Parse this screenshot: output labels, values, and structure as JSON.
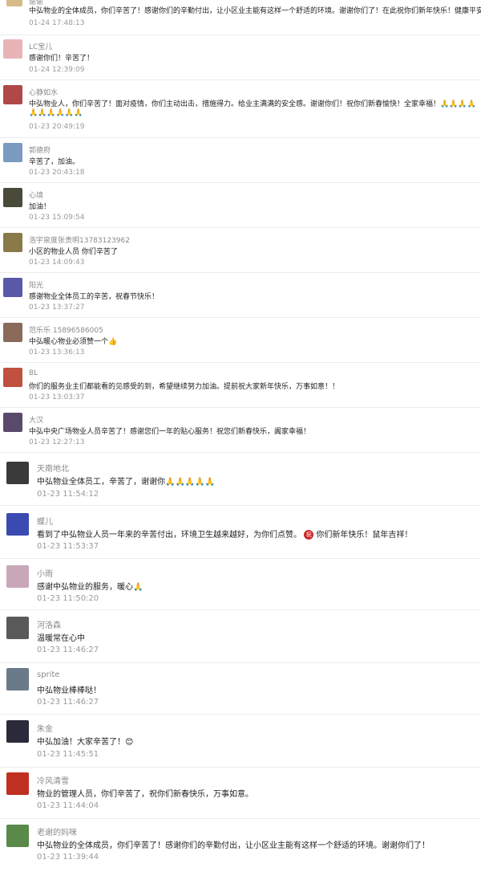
{
  "comments": [
    {
      "name": "谢谢",
      "text": "中弘物业的全体成员，你们辛苦了！感谢你们的辛勤付出，让小区业主能有这样一个舒适的环境。谢谢你们了！在此祝你们新年快乐！健康平安！",
      "time": "01-24 17:48:13",
      "avatar_color": "#d8b98a"
    },
    {
      "name": "LC宝儿",
      "text": "感谢你们！辛苦了！",
      "time": "01-24 12:39:09",
      "avatar_color": "#e8b4b8"
    },
    {
      "name": "心静如水",
      "text": "中弘物业人，你们辛苦了！面对疫情，你们主动出击，措施得力。给业主满满的安全感。谢谢你们！祝你们新春愉快！全家幸福！🙏🙏🙏🙏",
      "text2": "🙏🙏🙏🙏🙏🙏",
      "time": "01-23 20:49:19",
      "avatar_color": "#b04848"
    },
    {
      "name": "郭德府",
      "text": "辛苦了，加油。",
      "time": "01-23 20:43:18",
      "avatar_color": "#7a9ac0"
    },
    {
      "name": "心境",
      "text": "加油！",
      "time": "01-23 15:09:54",
      "avatar_color": "#4a4a3a"
    },
    {
      "name": "浩宇泉度张贵明13783123962",
      "text": "小区的物业人员 你们辛苦了",
      "time": "01-23 14:09:43",
      "avatar_color": "#8a7a4a"
    },
    {
      "name": "阳光",
      "text": "感谢物业全体员工的辛苦，祝春节快乐！",
      "time": "01-23 13:37:27",
      "avatar_color": "#5a58a8"
    },
    {
      "name": "范乐乐 15896586005",
      "text": "中弘暖心物业必须赞一个👍",
      "time": "01-23 13:36:13",
      "avatar_color": "#8a6a5a"
    },
    {
      "name": "BL",
      "text": "你们的服务业主们都能看的见感受的到，希望继续努力加油。提前祝大家新年快乐，万事如意！！",
      "time": "01-23 13:03:37",
      "avatar_color": "#c05040"
    },
    {
      "name": "大汉",
      "text": "中弘中央广场物业人员辛苦了！感谢您们一年的贴心服务！祝您们新春快乐，阖家幸福！",
      "time": "01-23 12:27:13",
      "avatar_color": "#5a4a6a"
    },
    {
      "name": "天南地北",
      "text": "中弘物业全体员工，辛苦了，谢谢你🙏🙏🙏🙏🙏",
      "time": "01-23 11:54:12",
      "avatar_color": "#3a3a3a"
    },
    {
      "name": "蝶儿",
      "text": "看到了中弘物业人员一年来的辛苦付出，环境卫生越来越好，为你们点赞。",
      "text_tail": "你们新年快乐！鼠年吉祥！",
      "badge": "祝",
      "time": "01-23 11:53:37",
      "avatar_color": "#3a4ab0"
    },
    {
      "name": "小雨",
      "text": "感谢中弘物业的服务，暖心🙏",
      "time": "01-23 11:50:20",
      "avatar_color": "#c8a8b8"
    },
    {
      "name": "河洛森",
      "text": "温暖常在心中",
      "time": "01-23 11:46:27",
      "avatar_color": "#5a5a5a"
    },
    {
      "name": "sprite",
      "text": "中弘物业棒棒哒！",
      "time": "01-23 11:46:27",
      "avatar_color": "#6a7a8a"
    },
    {
      "name": "朱金",
      "text": "中弘加油！大家辛苦了！😊",
      "time": "01-23 11:45:51",
      "avatar_color": "#2a2a3a"
    },
    {
      "name": "冷风清雪",
      "text": "物业的管理人员，你们辛苦了，祝你们新春快乐，万事如意。",
      "time": "01-23 11:44:04",
      "avatar_color": "#c03020"
    },
    {
      "name": "老谢的妈咪",
      "text": "中弘物业的全体成员，你们辛苦了！感谢你们的辛勤付出，让小区业主能有这样一个舒适的环境。谢谢你们了！",
      "time": "01-23 11:39:44",
      "avatar_color": "#5a8a4a"
    }
  ]
}
